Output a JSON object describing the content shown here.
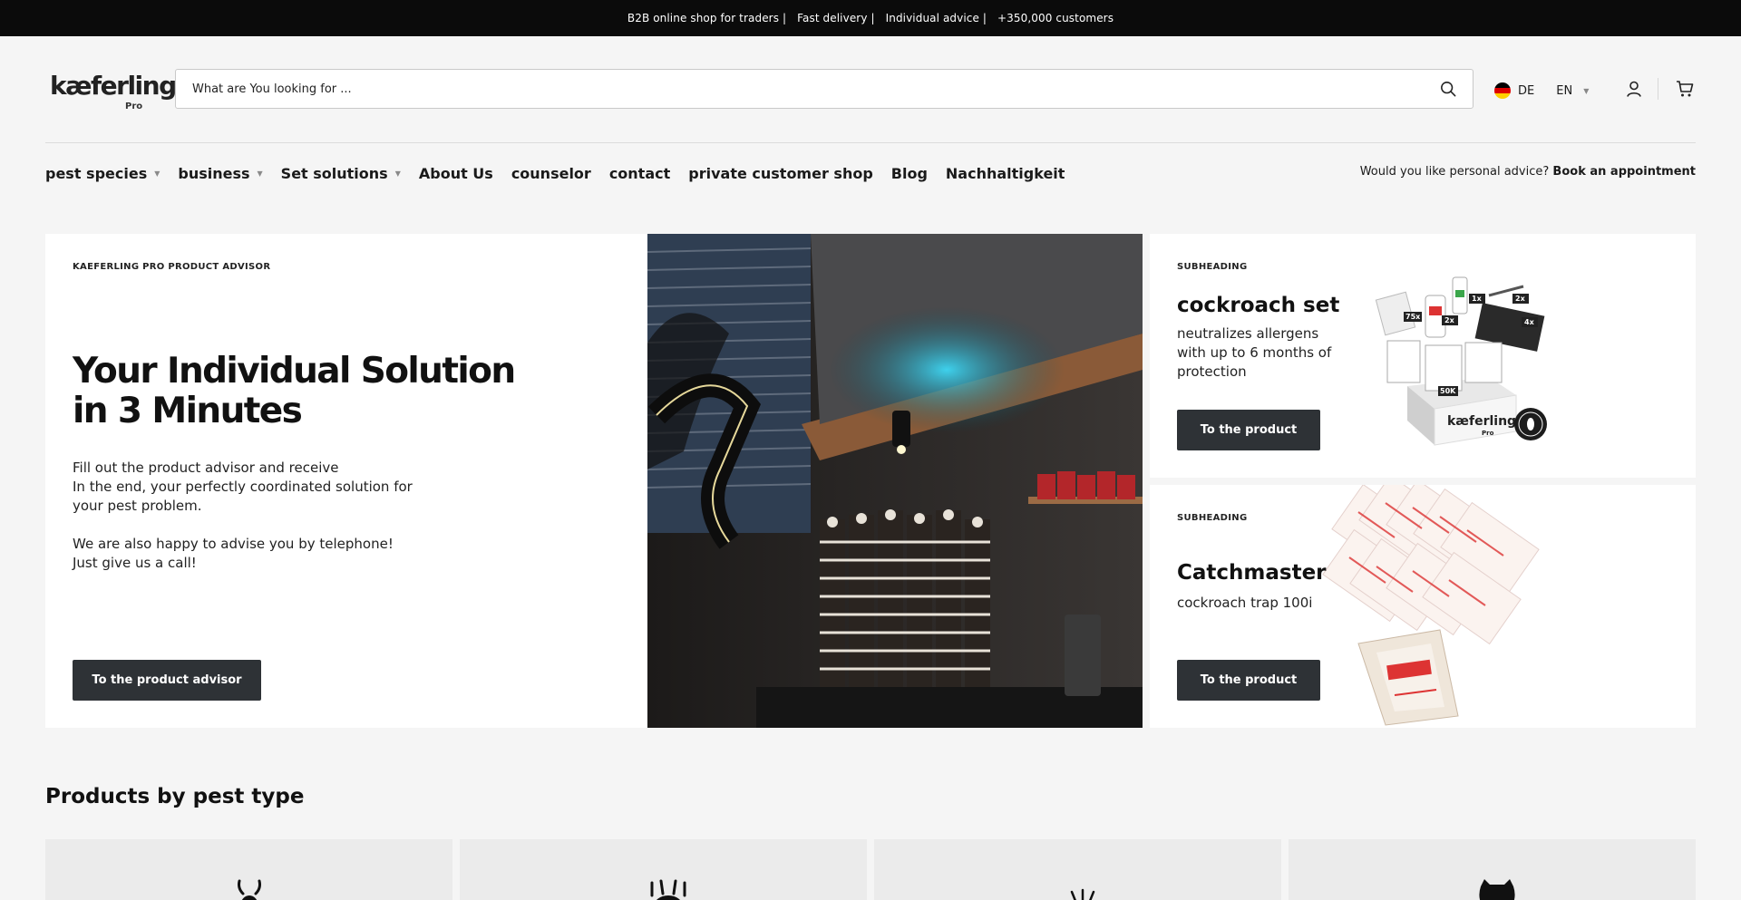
{
  "topbar": {
    "items": [
      "B2B online shop for traders |",
      "Fast delivery |",
      "Individual advice |",
      "+350,000 customers"
    ]
  },
  "header": {
    "logo_text": "kæferling",
    "logo_sub": "Pro",
    "search_placeholder": "What are You looking for ...",
    "lang_de": "DE",
    "lang_en": "EN",
    "icons": [
      "search-icon",
      "germany-flag-icon",
      "user-icon",
      "cart-icon"
    ]
  },
  "nav": {
    "items": [
      {
        "label": "pest species",
        "dropdown": true
      },
      {
        "label": "business",
        "dropdown": true
      },
      {
        "label": "Set solutions",
        "dropdown": true
      },
      {
        "label": "About Us",
        "dropdown": false
      },
      {
        "label": "counselor",
        "dropdown": false
      },
      {
        "label": "contact",
        "dropdown": false
      },
      {
        "label": "private customer shop",
        "dropdown": false
      },
      {
        "label": "Blog",
        "dropdown": false
      },
      {
        "label": "Nachhaltigkeit",
        "dropdown": false
      }
    ],
    "advice_question": "Would you like personal advice?",
    "advice_link": "Book an appointment"
  },
  "hero": {
    "eyebrow": "KAEFERLING PRO PRODUCT ADVISOR",
    "title": "Your Individual Solution in 3 Minutes",
    "paragraph1": "Fill out the product advisor and receive\nIn the end, your perfectly coordinated solution for\nyour pest problem.",
    "paragraph2": "We are also happy to advise you by telephone!\nJust give us a call!",
    "button": "To the product advisor"
  },
  "cards": [
    {
      "eyebrow": "SUBHEADING",
      "title": "cockroach set",
      "description": "neutralizes allergens with up to 6 months of protection",
      "button": "To the product",
      "image_labels": [
        "1x",
        "2x",
        "75x",
        "2x",
        "4x",
        "50K"
      ],
      "box_text": "kæferling",
      "box_sub": "Pro"
    },
    {
      "eyebrow": "SUBHEADING",
      "title": "Catchmaster",
      "description": "cockroach trap 100i",
      "button": "To the product"
    }
  ],
  "section": {
    "title": "Products by pest type",
    "tile_icons": [
      "cockroach-icon",
      "bedbug-icon",
      "ant-icon",
      "mouse-icon"
    ]
  },
  "colors": {
    "topbar_bg": "#0b0b0b",
    "page_bg": "#f5f5f5",
    "button_bg": "#2e3236",
    "tile_bg": "#ebebeb"
  }
}
